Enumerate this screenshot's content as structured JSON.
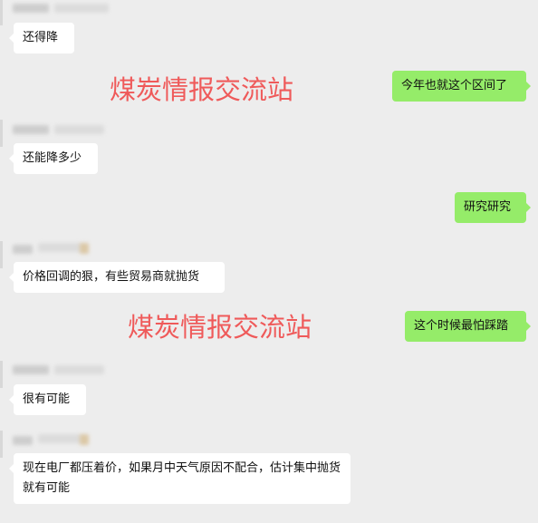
{
  "colors": {
    "background": "#ededed",
    "incoming_bubble": "#ffffff",
    "outgoing_bubble": "#95ec69",
    "watermark": "#ef5a5a"
  },
  "watermarks": {
    "top": "煤炭情报交流站",
    "middle": "煤炭情报交流站"
  },
  "messages": [
    {
      "side": "left",
      "text": "还得降"
    },
    {
      "side": "right",
      "text": "今年也就这个区间了"
    },
    {
      "side": "left",
      "text": "还能降多少"
    },
    {
      "side": "right",
      "text": "研究研究"
    },
    {
      "side": "left",
      "text": "价格回调的狠，有些贸易商就抛货"
    },
    {
      "side": "right",
      "text": "这个时候最怕踩踏"
    },
    {
      "side": "left",
      "text": "很有可能"
    },
    {
      "side": "left",
      "text": "现在电厂都压着价，如果月中天气原因不配合，估计集中抛货就有可能"
    }
  ]
}
